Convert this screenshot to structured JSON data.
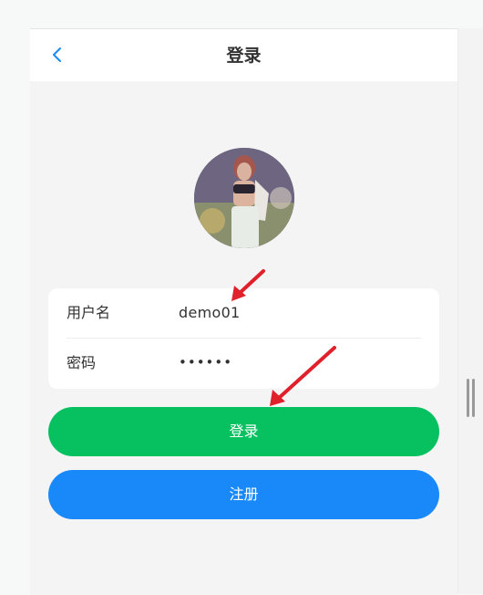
{
  "navbar": {
    "title": "登录",
    "back_icon": "chevron-left-icon"
  },
  "avatar": {
    "description": "user-avatar"
  },
  "form": {
    "username": {
      "label": "用户名",
      "value": "demo01"
    },
    "password": {
      "label": "密码",
      "value": "••••••"
    }
  },
  "buttons": {
    "login": "登录",
    "register": "注册"
  },
  "colors": {
    "login_button": "#07c160",
    "register_button": "#1989fa",
    "back_icon": "#1989fa",
    "annotation_arrow": "#e0202a",
    "page_background": "#f4f4f5"
  }
}
